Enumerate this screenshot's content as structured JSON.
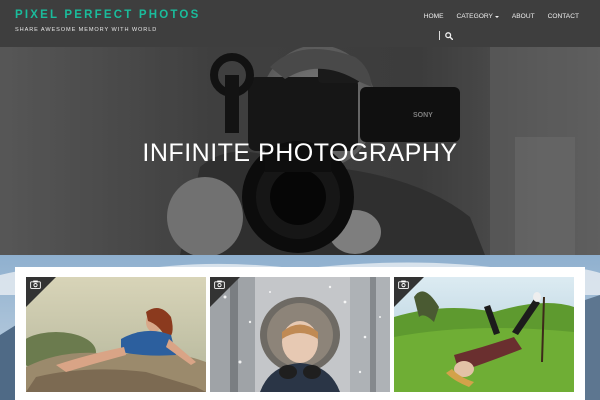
{
  "site": {
    "title": "PIXEL PERFECT PHOTOS",
    "tagline": "SHARE AWESOME MEMORY WITH WORLD",
    "accent_color": "#1abc9c"
  },
  "nav": {
    "items": [
      {
        "label": "HOME"
      },
      {
        "label": "CATEGORY",
        "has_dropdown": true
      },
      {
        "label": "ABOUT"
      },
      {
        "label": "CONTACT"
      }
    ],
    "search_icon": "search-icon"
  },
  "hero": {
    "title": "INFINITE PHOTOGRAPHY",
    "camera_brand": "SONY"
  },
  "gallery": {
    "items": [
      {
        "subject": "woman in blue dress reclining on rock",
        "icon": "camera-icon"
      },
      {
        "subject": "woman in fur hood blowing snow",
        "icon": "camera-icon"
      },
      {
        "subject": "woman lying on grass",
        "icon": "camera-icon"
      }
    ]
  }
}
